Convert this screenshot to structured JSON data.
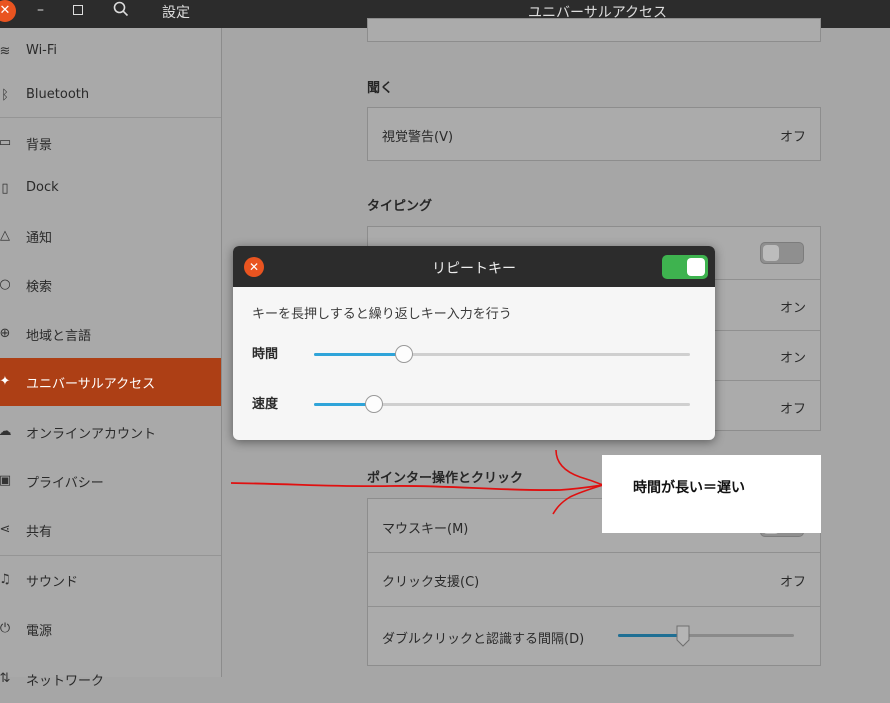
{
  "window": {
    "app_title": "設定",
    "panel_title": "ユニバーサルアクセス",
    "close_glyph": "✕",
    "minimize_glyph": "–"
  },
  "sidebar": {
    "items": [
      {
        "label": "Wi-Fi",
        "icon": "wifi-icon",
        "glyph": "≋"
      },
      {
        "label": "Bluetooth",
        "icon": "bluetooth-icon",
        "glyph": "ᛒ"
      },
      {
        "label": "背景",
        "icon": "background-icon",
        "glyph": "▭"
      },
      {
        "label": "Dock",
        "icon": "dock-icon",
        "glyph": "▯"
      },
      {
        "label": "通知",
        "icon": "bell-icon",
        "glyph": "△"
      },
      {
        "label": "検索",
        "icon": "search-icon",
        "glyph": "○"
      },
      {
        "label": "地域と言語",
        "icon": "globe-icon",
        "glyph": "⊕"
      },
      {
        "label": "ユニバーサルアクセス",
        "icon": "accessibility-icon",
        "glyph": "✦"
      },
      {
        "label": "オンラインアカウント",
        "icon": "cloud-icon",
        "glyph": "☁"
      },
      {
        "label": "プライバシー",
        "icon": "lock-icon",
        "glyph": "▣"
      },
      {
        "label": "共有",
        "icon": "share-icon",
        "glyph": "⋖"
      },
      {
        "label": "サウンド",
        "icon": "music-note-icon",
        "glyph": "♫"
      },
      {
        "label": "電源",
        "icon": "power-icon",
        "glyph": "⏻"
      },
      {
        "label": "ネットワーク",
        "icon": "network-icon",
        "glyph": "⇅"
      }
    ]
  },
  "main": {
    "hearing": {
      "title": "聞く",
      "rows": [
        {
          "label": "視覚警告(V)",
          "value": "オフ"
        }
      ]
    },
    "typing": {
      "title": "タイピング",
      "values": [
        "オン",
        "オン",
        "オフ"
      ]
    },
    "pointer": {
      "title": "ポインター操作とクリック",
      "rows": [
        {
          "label": "マウスキー(M)"
        },
        {
          "label": "クリック支援(C)",
          "value": "オフ"
        },
        {
          "label": "ダブルクリックと認識する間隔(D)",
          "slider_level": 0.37
        }
      ]
    }
  },
  "dialog": {
    "title": "リピートキー",
    "enabled": true,
    "description": "キーを長押しすると繰り返しキー入力を行う",
    "delay_label": "時間",
    "delay_level": 0.24,
    "speed_label": "速度",
    "speed_level": 0.16,
    "close_glyph": "✕"
  },
  "annotation": {
    "text": "時間が長い＝遅い",
    "color": "#e01010"
  },
  "colors": {
    "accent": "#ad3f15",
    "close_button": "#e95420",
    "toggle_on": "#3eb34f",
    "slider_fill": "#2fa4d9"
  }
}
